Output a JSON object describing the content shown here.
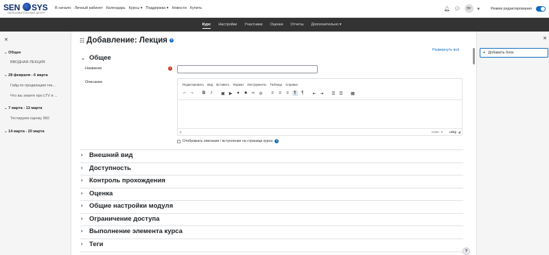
{
  "logo": {
    "left": "SEN",
    "right": "SYS",
    "subtitle": "ОБРАЗОВАТЕЛЬНЫЙ ЦЕНТР"
  },
  "topnav": [
    "В начало",
    "Личный кабинет",
    "Календарь",
    "Курсы ▾",
    "Поддержка ▾",
    "Новости",
    "Купить"
  ],
  "user": {
    "initials": "ПР",
    "edit_mode_label": "Режим редактирования"
  },
  "coursenav": [
    "Курс",
    "Настройки",
    "Участники",
    "Оценки",
    "Отчеты",
    "Дополнительно ▾"
  ],
  "leftdrawer": {
    "sections": [
      {
        "title": "Общее",
        "items": [
          "ВВОДНАЯ ЛЕКЦИЯ"
        ]
      },
      {
        "title": "28 февраля - 6 марта",
        "items": [
          "Гайд по продающим тек...",
          "Что вы знаете про LTV и ..."
        ]
      },
      {
        "title": "7 марта - 13 марта",
        "items": [
          "Тестируем оценку 360"
        ]
      },
      {
        "title": "14 марта - 20 марта",
        "items": []
      }
    ]
  },
  "rightdrawer": {
    "add_block": "Добавить блок"
  },
  "page": {
    "title": "Добавление: Лекция",
    "expand_all": "Развернуть всё",
    "general_section": "Общее",
    "name_label": "Название",
    "description_label": "Описание",
    "editor_menu": [
      "Редактировать",
      "Вид",
      "Вставить",
      "Формат",
      "Инструменты",
      "Таблица",
      "Справка"
    ],
    "editor_path": "p",
    "editor_wordcount": "слов : 0",
    "editor_brand": "tiny",
    "show_description_label": "Отображать описание / вступление на странице курса",
    "sections": [
      "Внешний вид",
      "Доступность",
      "Контроль прохождения",
      "Оценка",
      "Общие настройки модуля",
      "Ограничение доступа",
      "Выполнение элемента курса",
      "Теги"
    ]
  },
  "colors": {
    "accent": "#0f6cbf",
    "navbar": "#333333",
    "required": "#ca3120"
  }
}
